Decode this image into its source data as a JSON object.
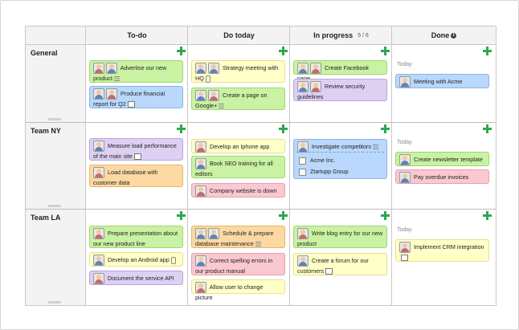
{
  "columns": [
    {
      "label": "To-do"
    },
    {
      "label": "Do today"
    },
    {
      "label": "In progress",
      "sub": "5 / 6"
    },
    {
      "label": "Done"
    }
  ],
  "rows": [
    {
      "label": "General"
    },
    {
      "label": "Team NY"
    },
    {
      "label": "Team LA"
    }
  ],
  "today_label": "Today",
  "cards": {
    "advertise": "Advertise our new product",
    "produce_report": "Produce financial report for Q2",
    "strategy_meeting": "Strategy meeting with HQ",
    "create_page": "Create a page on Google+",
    "create_facebook": "Create Facebook page",
    "review_security": "Review security guidelines",
    "meeting_acme": "Meeting with Acme",
    "measure_load": "Measure load performance of the main site",
    "load_database": "Load database with customer data",
    "iphone_app": "Develop an Iphone app",
    "seo_training": "Book SEO training for all editors",
    "website_down": "Company website is down",
    "investigate": "Investigate competitors",
    "acme_inc": "Acme Inc.",
    "ztartupp": "Ztartupp Group",
    "newsletter": "Create newsletter template",
    "overdue": "Pay overdue invoices",
    "presentation": "Prepare presentation about our new product line",
    "android_app": "Develop an Android app",
    "document_api": "Document the service API",
    "schedule": "Schedule & prepare database maintenance",
    "spelling": "Correct spelling errors in our product manual",
    "picture": "Allow user to change picture",
    "blog_entry": "Write blog entry for our new product",
    "forum": "Create a forum for our customers",
    "crm": "Implement CRM integration"
  },
  "colors": {
    "green": "#c9f2a2",
    "blue": "#b9d8fb",
    "purple": "#ddd0f2",
    "orange": "#fcd9a3",
    "yellow": "#ffffc8",
    "pink": "#fac8d1",
    "add": "#2fa84f"
  },
  "icons": [
    "add-icon",
    "avatar-icon",
    "info-icon",
    "comment-icon",
    "checklist-icon",
    "attachment-icon",
    "checkbox-icon"
  ]
}
